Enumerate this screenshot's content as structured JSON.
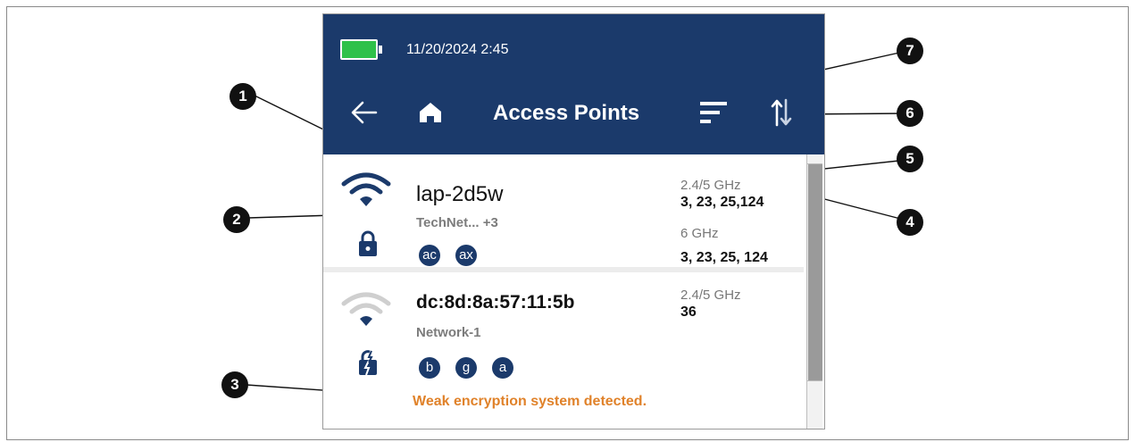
{
  "status_bar": {
    "datetime": "11/20/2024 2:45",
    "battery_color": "#2ec14a"
  },
  "header": {
    "title": "Access Points",
    "back_icon": "arrow-left-icon",
    "home_icon": "home-icon",
    "filter_icon": "filter-lines-icon",
    "sort_icon": "sort-up-down-icon",
    "color": "#1b3a6b"
  },
  "access_points": [
    {
      "name": "lap-2d5w",
      "network": "TechNet... +3",
      "signal_icon": "wifi-strong-icon",
      "security_icon": "lock-icon",
      "standards": [
        "ac",
        "ax"
      ],
      "bands": [
        {
          "label": "2.4/5 GHz",
          "channels": "3, 23, 25,124"
        },
        {
          "label": "6 GHz",
          "channels": "3, 23, 25, 124"
        }
      ]
    },
    {
      "name": "dc:8d:8a:57:11:5b",
      "network": "Network-1",
      "signal_icon": "wifi-weak-icon",
      "security_icon": "weak-lock-icon",
      "standards": [
        "b",
        "g",
        "a"
      ],
      "bands": [
        {
          "label": "2.4/5 GHz",
          "channels": "36"
        }
      ],
      "warning": "Weak encryption system detected.",
      "warning_color": "#e0822a"
    }
  ],
  "callouts": [
    "1",
    "2",
    "3",
    "4",
    "5",
    "6",
    "7"
  ]
}
